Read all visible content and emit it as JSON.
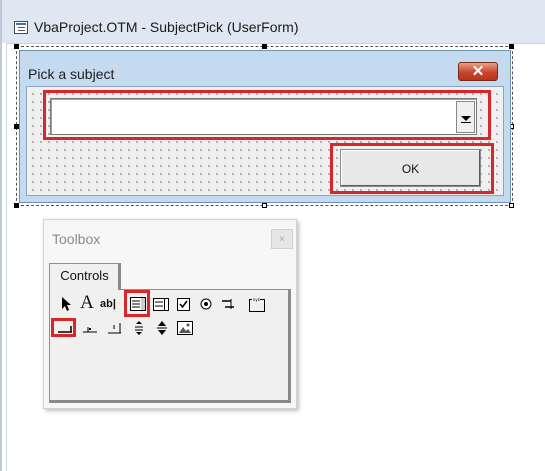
{
  "code_window": {
    "title": "VbaProject.OTM - SubjectPick (UserForm)",
    "icon": "userform-window-icon"
  },
  "userform": {
    "caption": "Pick a subject",
    "close_icon": "close-icon",
    "close_glyph": "✕",
    "combo_value": "",
    "ok_label": "OK",
    "combo_highlighted": true,
    "ok_highlighted": true
  },
  "toolbox": {
    "title": "Toolbox",
    "close_glyph": "✕",
    "tabs": [
      {
        "label": "Controls",
        "selected": true
      }
    ],
    "row1": [
      {
        "name": "select-objects-tool",
        "glyph": "↖"
      },
      {
        "name": "label-tool",
        "glyph": "A"
      },
      {
        "name": "textbox-tool",
        "glyph": "ab|"
      },
      {
        "name": "combobox-tool",
        "glyph": "▤",
        "highlighted": true
      },
      {
        "name": "listbox-tool",
        "glyph": "▥"
      },
      {
        "name": "checkbox-tool",
        "glyph": "☑"
      },
      {
        "name": "optionbutton-tool",
        "glyph": "◉"
      },
      {
        "name": "togglebutton-tool",
        "glyph": "≡"
      },
      {
        "name": "frame-tool",
        "glyph": "⬚"
      }
    ],
    "row2": [
      {
        "name": "commandbutton-tool",
        "glyph": "▁",
        "highlighted": true
      },
      {
        "name": "tabstrip-tool",
        "glyph": "▄"
      },
      {
        "name": "multipage-tool",
        "glyph": "┐"
      },
      {
        "name": "scrollbar-tool",
        "glyph": "⬍"
      },
      {
        "name": "spinbutton-tool",
        "glyph": "⇕"
      },
      {
        "name": "image-tool",
        "glyph": "▨"
      }
    ]
  },
  "colors": {
    "highlight": "#d9262a",
    "form_background": "#c5d9ef"
  }
}
